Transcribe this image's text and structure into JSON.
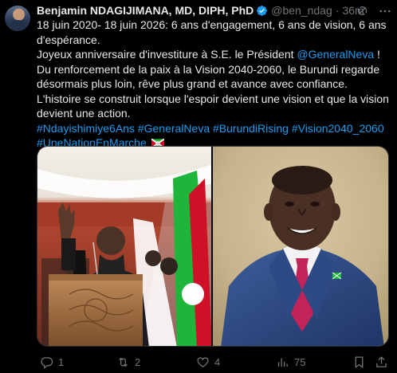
{
  "author": {
    "name": "Benjamin NDAGIJIMANA, MD, DIPH, PhD",
    "handle": "@ben_ndag",
    "time": "36m",
    "separator": "·"
  },
  "text": {
    "line1": "18 juin 2020- 18 juin 2026: 6 ans d'engagement, 6 ans de vision, 6 ans",
    "line2": "d'espérance.",
    "line3_pre": "Joyeux anniversaire d'investiture à S.E. le Président ",
    "line3_mention": "@GeneralNeva",
    "line3_post": " !",
    "line4": "Du renforcement de la paix à la Vision 2040-2060, le Burundi regarde",
    "line5": "désormais plus loin, rêve plus grand et avance avec confiance.",
    "line6": "L'histoire se construit lorsque l'espoir devient une vision et que la vision",
    "line7": "devient une action.",
    "hashtags": [
      "#Ndayishimiye6Ans",
      "#GeneralNeva",
      "#BurundiRising",
      "#Vision2040_2060",
      "#UneNationEnMarche"
    ]
  },
  "actions": {
    "replies": "1",
    "reposts": "2",
    "likes": "4",
    "views": "75"
  },
  "icons": {
    "verified": "verified-badge-icon",
    "grok": "grok-icon",
    "more": "more-options-icon",
    "reply": "reply-icon",
    "repost": "repost-icon",
    "like": "heart-icon",
    "views": "views-chart-icon",
    "bookmark": "bookmark-icon",
    "share": "share-icon",
    "flag": "burundi-flag-emoji"
  },
  "colors": {
    "background": "#000000",
    "text": "#e7e9ea",
    "secondary": "#71767b",
    "link": "#1d9bf0",
    "border": "#2f3336"
  }
}
